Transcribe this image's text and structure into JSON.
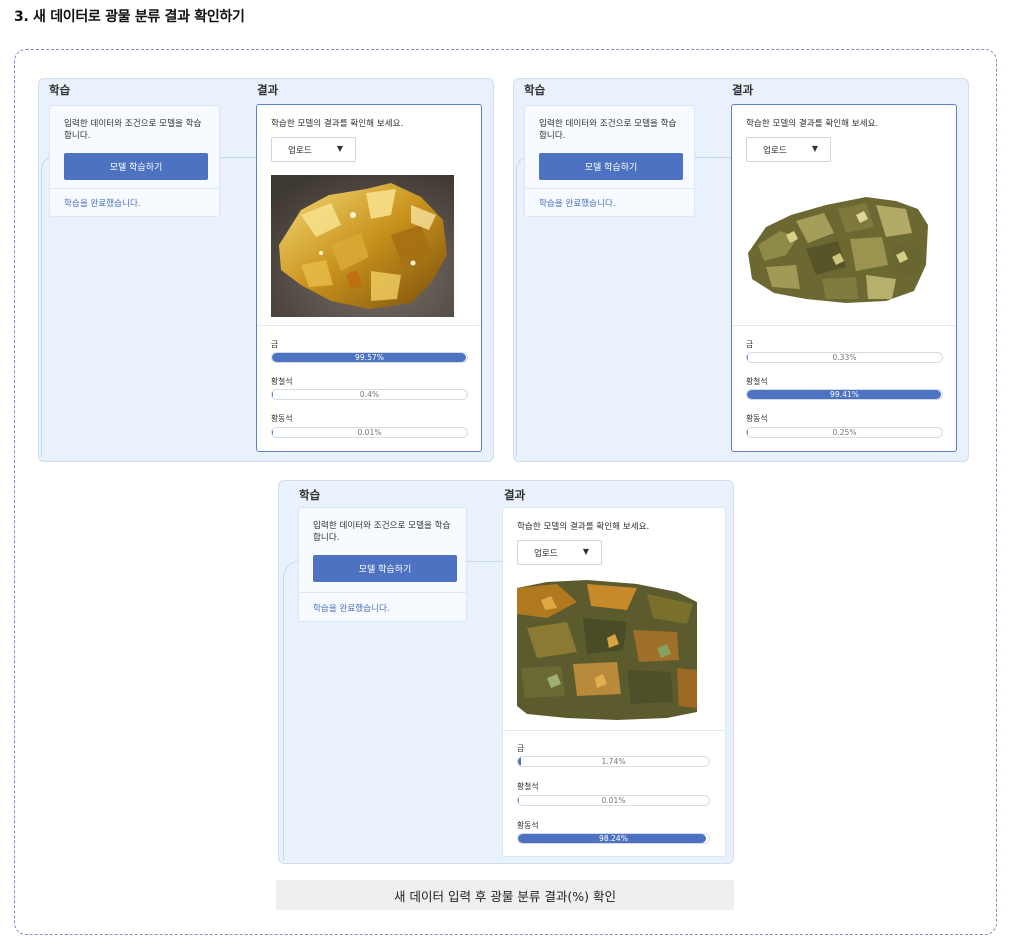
{
  "heading": "3. 새 데이터로 광물 분류 결과 확인하기",
  "panels": [
    {
      "train_header": "학습",
      "result_header": "결과",
      "train_desc": "입력한 데이터와 조건으로 모델을 학습합니다.",
      "train_button": "모델 학습하기",
      "train_status": "학습을 완료했습니다.",
      "result_prompt": "학습한 모델의 결과를 확인해 보세요.",
      "select_value": "업로드",
      "image_subject": "gold nugget",
      "results": [
        {
          "label": "금",
          "value": 99.57,
          "text": "99.57%"
        },
        {
          "label": "황철석",
          "value": 0.4,
          "text": "0.4%"
        },
        {
          "label": "황동석",
          "value": 0.01,
          "text": "0.01%"
        }
      ]
    },
    {
      "train_header": "학습",
      "result_header": "결과",
      "train_desc": "입력한 데이터와 조건으로 모델을 학습합니다.",
      "train_button": "모델 학습하기",
      "train_status": "학습을 완료했습니다.",
      "result_prompt": "학습한 모델의 결과를 확인해 보세요.",
      "select_value": "업로드",
      "image_subject": "pyrite crystals",
      "results": [
        {
          "label": "금",
          "value": 0.33,
          "text": "0.33%"
        },
        {
          "label": "황철석",
          "value": 99.41,
          "text": "99.41%"
        },
        {
          "label": "황동석",
          "value": 0.25,
          "text": "0.25%"
        }
      ]
    },
    {
      "train_header": "학습",
      "result_header": "결과",
      "train_desc": "입력한 데이터와 조건으로 모델을 학습합니다.",
      "train_button": "모델 학습하기",
      "train_status": "학습을 완료했습니다.",
      "result_prompt": "학습한 모델의 결과를 확인해 보세요.",
      "select_value": "업로드",
      "image_subject": "chalcopyrite rock",
      "results": [
        {
          "label": "금",
          "value": 1.74,
          "text": "1.74%"
        },
        {
          "label": "황철석",
          "value": 0.01,
          "text": "0.01%"
        },
        {
          "label": "황동석",
          "value": 98.24,
          "text": "98.24%"
        }
      ]
    }
  ],
  "caption": "새 데이터 입력 후 광물 분류 결과(%) 확인",
  "colors": {
    "accent": "#4c72c1",
    "panel_bg": "#e9f2fc",
    "frame": "#8e88c6"
  }
}
